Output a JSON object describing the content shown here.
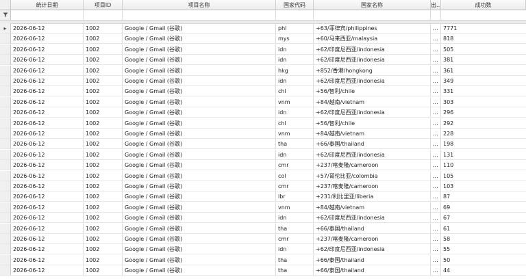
{
  "columns": [
    "统计日期",
    "项目ID",
    "项目名称",
    "国家代码",
    "国家名称",
    "出…",
    "成功数"
  ],
  "filter_icon": "filter-icon",
  "row_indicator": "▸",
  "rows": [
    {
      "date": "2026-06-12",
      "pid": "1002",
      "pname": "Google / Gmail (谷歌)",
      "code": "phl",
      "country": "+63/菲律宾/philippines",
      "extra": "...",
      "count": "7771"
    },
    {
      "date": "2026-06-12",
      "pid": "1002",
      "pname": "Google / Gmail (谷歌)",
      "code": "mys",
      "country": "+60/马来西亚/malaysia",
      "extra": "...",
      "count": "818"
    },
    {
      "date": "2026-06-12",
      "pid": "1002",
      "pname": "Google / Gmail (谷歌)",
      "code": "idn",
      "country": "+62/印度尼西亚/indonesia",
      "extra": "...",
      "count": "505"
    },
    {
      "date": "2026-06-12",
      "pid": "1002",
      "pname": "Google / Gmail (谷歌)",
      "code": "idn",
      "country": "+62/印度尼西亚/indonesia",
      "extra": "...",
      "count": "381"
    },
    {
      "date": "2026-06-12",
      "pid": "1002",
      "pname": "Google / Gmail (谷歌)",
      "code": "hkg",
      "country": "+852/香港/hongkong",
      "extra": "...",
      "count": "361"
    },
    {
      "date": "2026-06-12",
      "pid": "1002",
      "pname": "Google / Gmail (谷歌)",
      "code": "idn",
      "country": "+62/印度尼西亚/indonesia",
      "extra": "...",
      "count": "349"
    },
    {
      "date": "2026-06-12",
      "pid": "1002",
      "pname": "Google / Gmail (谷歌)",
      "code": "chl",
      "country": "+56/智利/chile",
      "extra": "...",
      "count": "331"
    },
    {
      "date": "2026-06-12",
      "pid": "1002",
      "pname": "Google / Gmail (谷歌)",
      "code": "vnm",
      "country": "+84/越南/vietnam",
      "extra": "...",
      "count": "303"
    },
    {
      "date": "2026-06-12",
      "pid": "1002",
      "pname": "Google / Gmail (谷歌)",
      "code": "idn",
      "country": "+62/印度尼西亚/indonesia",
      "extra": "...",
      "count": "296"
    },
    {
      "date": "2026-06-12",
      "pid": "1002",
      "pname": "Google / Gmail (谷歌)",
      "code": "chl",
      "country": "+56/智利/chile",
      "extra": "...",
      "count": "292"
    },
    {
      "date": "2026-06-12",
      "pid": "1002",
      "pname": "Google / Gmail (谷歌)",
      "code": "vnm",
      "country": "+84/越南/vietnam",
      "extra": "...",
      "count": "228"
    },
    {
      "date": "2026-06-12",
      "pid": "1002",
      "pname": "Google / Gmail (谷歌)",
      "code": "tha",
      "country": "+66/泰国/thailand",
      "extra": "...",
      "count": "198"
    },
    {
      "date": "2026-06-12",
      "pid": "1002",
      "pname": "Google / Gmail (谷歌)",
      "code": "idn",
      "country": "+62/印度尼西亚/indonesia",
      "extra": "...",
      "count": "131"
    },
    {
      "date": "2026-06-12",
      "pid": "1002",
      "pname": "Google / Gmail (谷歌)",
      "code": "cmr",
      "country": "+237/喀麦隆/cameroon",
      "extra": "...",
      "count": "110"
    },
    {
      "date": "2026-06-12",
      "pid": "1002",
      "pname": "Google / Gmail (谷歌)",
      "code": "col",
      "country": "+57/哥伦比亚/colombia",
      "extra": "...",
      "count": "105"
    },
    {
      "date": "2026-06-12",
      "pid": "1002",
      "pname": "Google / Gmail (谷歌)",
      "code": "cmr",
      "country": "+237/喀麦隆/cameroon",
      "extra": "...",
      "count": "103"
    },
    {
      "date": "2026-06-12",
      "pid": "1002",
      "pname": "Google / Gmail (谷歌)",
      "code": "lbr",
      "country": "+231/利比里亚/liberia",
      "extra": "...",
      "count": "87"
    },
    {
      "date": "2026-06-12",
      "pid": "1002",
      "pname": "Google / Gmail (谷歌)",
      "code": "vnm",
      "country": "+84/越南/vietnam",
      "extra": "...",
      "count": "69"
    },
    {
      "date": "2026-06-12",
      "pid": "1002",
      "pname": "Google / Gmail (谷歌)",
      "code": "idn",
      "country": "+62/印度尼西亚/indonesia",
      "extra": "...",
      "count": "67"
    },
    {
      "date": "2026-06-12",
      "pid": "1002",
      "pname": "Google / Gmail (谷歌)",
      "code": "tha",
      "country": "+66/泰国/thailand",
      "extra": "...",
      "count": "61"
    },
    {
      "date": "2026-06-12",
      "pid": "1002",
      "pname": "Google / Gmail (谷歌)",
      "code": "cmr",
      "country": "+237/喀麦隆/cameroon",
      "extra": "...",
      "count": "58"
    },
    {
      "date": "2026-06-12",
      "pid": "1002",
      "pname": "Google / Gmail (谷歌)",
      "code": "idn",
      "country": "+62/印度尼西亚/indonesia",
      "extra": "...",
      "count": "55"
    },
    {
      "date": "2026-06-12",
      "pid": "1002",
      "pname": "Google / Gmail (谷歌)",
      "code": "tha",
      "country": "+66/泰国/thailand",
      "extra": "...",
      "count": "50"
    },
    {
      "date": "2026-06-12",
      "pid": "1002",
      "pname": "Google / Gmail (谷歌)",
      "code": "tha",
      "country": "+66/泰国/thailand",
      "extra": "...",
      "count": "44"
    }
  ]
}
